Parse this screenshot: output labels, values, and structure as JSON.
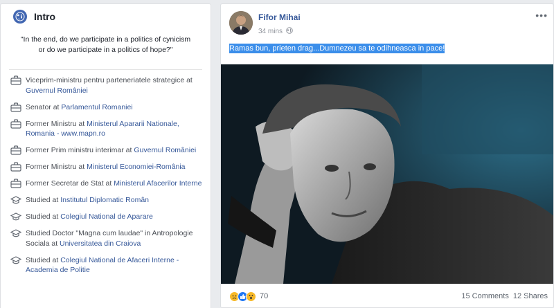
{
  "intro": {
    "title": "Intro",
    "bio": "\"In the end, do we participate in a politics of cynicism or do we participate in a politics of hope?\"",
    "items": [
      {
        "icon": "briefcase-icon",
        "prefix": "Viceprim-ministru pentru parteneriatele strategice at ",
        "link": "Guvernul României"
      },
      {
        "icon": "briefcase-icon",
        "prefix": "Senator at ",
        "link": "Parlamentul Romaniei"
      },
      {
        "icon": "briefcase-icon",
        "prefix": "Former Ministru at ",
        "link": "Ministerul Apararii Nationale, Romania - www.mapn.ro"
      },
      {
        "icon": "briefcase-icon",
        "prefix": "Former Prim ministru interimar at ",
        "link": "Guvernul României"
      },
      {
        "icon": "briefcase-icon",
        "prefix": "Former Ministru at ",
        "link": "Ministerul Economiei-România"
      },
      {
        "icon": "briefcase-icon",
        "prefix": "Former Secretar de Stat at ",
        "link": "Ministerul Afacerilor Interne"
      },
      {
        "icon": "graduation-cap-icon",
        "prefix": "Studied at ",
        "link": "Institutul Diplomatic Român"
      },
      {
        "icon": "graduation-cap-icon",
        "prefix": "Studied at ",
        "link": "Colegiul National de Aparare"
      },
      {
        "icon": "graduation-cap-icon",
        "prefix": "Studied Doctor \"Magna cum laudae\" in Antropologie Sociala at ",
        "link": "Universitatea din Craiova"
      },
      {
        "icon": "graduation-cap-icon",
        "prefix": "Studied at ",
        "link": "Colegiul National de Afaceri Interne - Academia de Politie"
      }
    ]
  },
  "post": {
    "author": "Fifor Mihai",
    "time": "34 mins",
    "privacy_icon": "globe-icon",
    "more_label": "•••",
    "text": "Ramas bun, prieten drag...Dumnezeu sa te odihneasca in pace!",
    "photo_icon": "photo-man-portrait",
    "reactions": {
      "types": [
        "sad-reaction-icon",
        "like-reaction-icon",
        "wow-reaction-icon"
      ],
      "count": "70"
    },
    "comments": "15 Comments",
    "shares": "12 Shares"
  },
  "colors": {
    "link": "#365899",
    "background": "#e9ebee",
    "highlight": "#3b8eea"
  }
}
